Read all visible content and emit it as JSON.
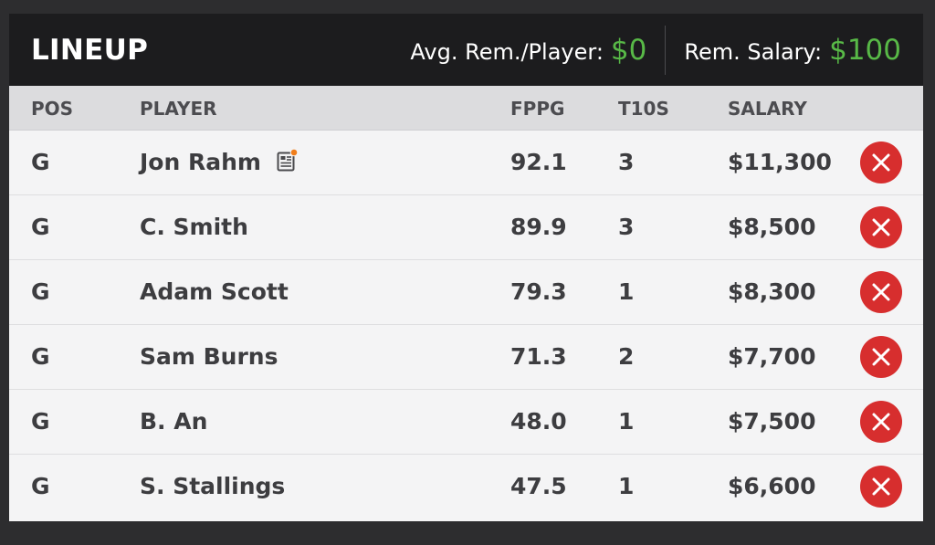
{
  "header": {
    "title": "LINEUP",
    "avg_rem_label": "Avg. Rem./Player:",
    "avg_rem_value": "$0",
    "rem_salary_label": "Rem. Salary:",
    "rem_salary_value": "$100"
  },
  "columns": {
    "pos": "POS",
    "player": "PLAYER",
    "fppg": "FPPG",
    "t10s": "T10S",
    "salary": "SALARY"
  },
  "rows": [
    {
      "pos": "G",
      "player": "Jon Rahm",
      "fppg": "92.1",
      "t10s": "3",
      "salary": "$11,300",
      "has_news": true
    },
    {
      "pos": "G",
      "player": "C. Smith",
      "fppg": "89.9",
      "t10s": "3",
      "salary": "$8,500",
      "has_news": false
    },
    {
      "pos": "G",
      "player": "Adam Scott",
      "fppg": "79.3",
      "t10s": "1",
      "salary": "$8,300",
      "has_news": false
    },
    {
      "pos": "G",
      "player": "Sam Burns",
      "fppg": "71.3",
      "t10s": "2",
      "salary": "$7,700",
      "has_news": false
    },
    {
      "pos": "G",
      "player": "B. An",
      "fppg": "48.0",
      "t10s": "1",
      "salary": "$7,500",
      "has_news": false
    },
    {
      "pos": "G",
      "player": "S. Stallings",
      "fppg": "47.5",
      "t10s": "1",
      "salary": "$6,600",
      "has_news": false
    }
  ],
  "icons": {
    "news": "player-news-icon",
    "remove": "remove-player-icon"
  },
  "colors": {
    "accent_green": "#58b947",
    "remove_red": "#d72e2e",
    "news_dot_orange": "#f07d1a"
  }
}
